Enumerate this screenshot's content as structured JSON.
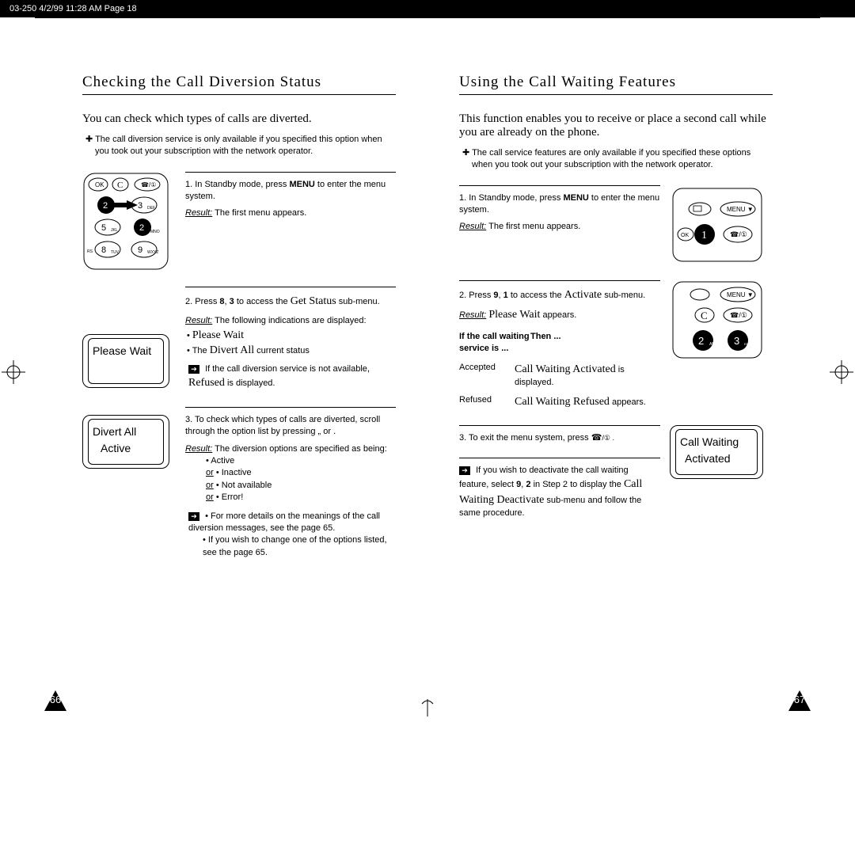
{
  "header": {
    "slug": "03-250  4/2/99 11:28 AM  Page 18"
  },
  "left": {
    "title": "Checking the Call Diversion Status",
    "lead": "You can check which types of calls are diverted.",
    "note": "The call diversion service is only available if you specified this option when you took out your subscription with the network operator.",
    "step1": {
      "text_a": "1. In Standby mode, press ",
      "bold": "MENU",
      "text_b": " to enter the menu system.",
      "result_label": "Result:",
      "result_text": " The first menu appears."
    },
    "step2": {
      "text_a": "2. Press ",
      "b1": "8",
      "sep": ", ",
      "b2": "3",
      "text_b": " to access the ",
      "big_a": "Get Status",
      "text_c": " sub-menu.",
      "result_label": "Result:",
      "result_text": " The following indications are displayed:",
      "bullet1_a": "• ",
      "bullet1_big": "Please Wait",
      "bullet2_a": "• The ",
      "bullet2_big": "Divert All",
      "bullet2_b": " current status",
      "note_a": "If the call diversion service is not available, ",
      "note_big": "Refused",
      "note_b": " is displayed."
    },
    "screen1": "Please Wait",
    "step3": {
      "text_a": "3. To check which types of calls are diverted, scroll through the option list by pressing „   or     .",
      "result_label": "Result:",
      "result_text": " The diversion options are specified as being:",
      "opts": [
        "• Active",
        "• Inactive",
        "• Not available",
        "• Error!"
      ],
      "or": "or",
      "tip1": "• For more details on the meanings of the call diversion messages, see the page 65.",
      "tip2": "• If you wish to change one of the options listed, see the page 65."
    },
    "screen2_l1": "Divert All",
    "screen2_l2": "Active",
    "pagenum": "66"
  },
  "right": {
    "title": "Using the Call Waiting Features",
    "lead": "This function enables you to receive or place a second call while you are already on the phone.",
    "note": "The call service features are only available if you specified these options when you took out your subscription with the network operator.",
    "step1": {
      "text_a": "1. In Standby mode, press ",
      "bold": "MENU",
      "text_b": " to enter the menu system.",
      "result_label": "Result:",
      "result_text": " The first menu appears."
    },
    "step2": {
      "text_a": "2. Press ",
      "b1": "9",
      "sep": ", ",
      "b2": "1",
      "text_b": " to access the ",
      "big_a": "Activate",
      "text_c": " sub-menu.",
      "result_label": "Result:",
      "result_big": "Please Wait",
      "result_text": " appears.",
      "th1": "If the call waiting service is ...",
      "th2": "Then ...",
      "row1_a": "Accepted",
      "row1_big": "Call Waiting Activated",
      "row1_b": " is displayed.",
      "row2_a": "Refused",
      "row2_big": "Call Waiting Refused",
      "row2_b": " appears."
    },
    "step3": {
      "text_a": "3. To exit the menu system, press ",
      "icon": "☎",
      "text_b": "/① ."
    },
    "tip": {
      "a": "If you wish to deactivate the call waiting feature, select ",
      "b1": "9",
      "sep": ", ",
      "b2": "2",
      "b": " in Step 2 to display the ",
      "big": "Call Waiting Deactivate",
      "c": " sub-menu and follow the same procedure."
    },
    "screen_l1": "Call Waiting",
    "screen_l2": "Activated",
    "pagenum": "67"
  }
}
